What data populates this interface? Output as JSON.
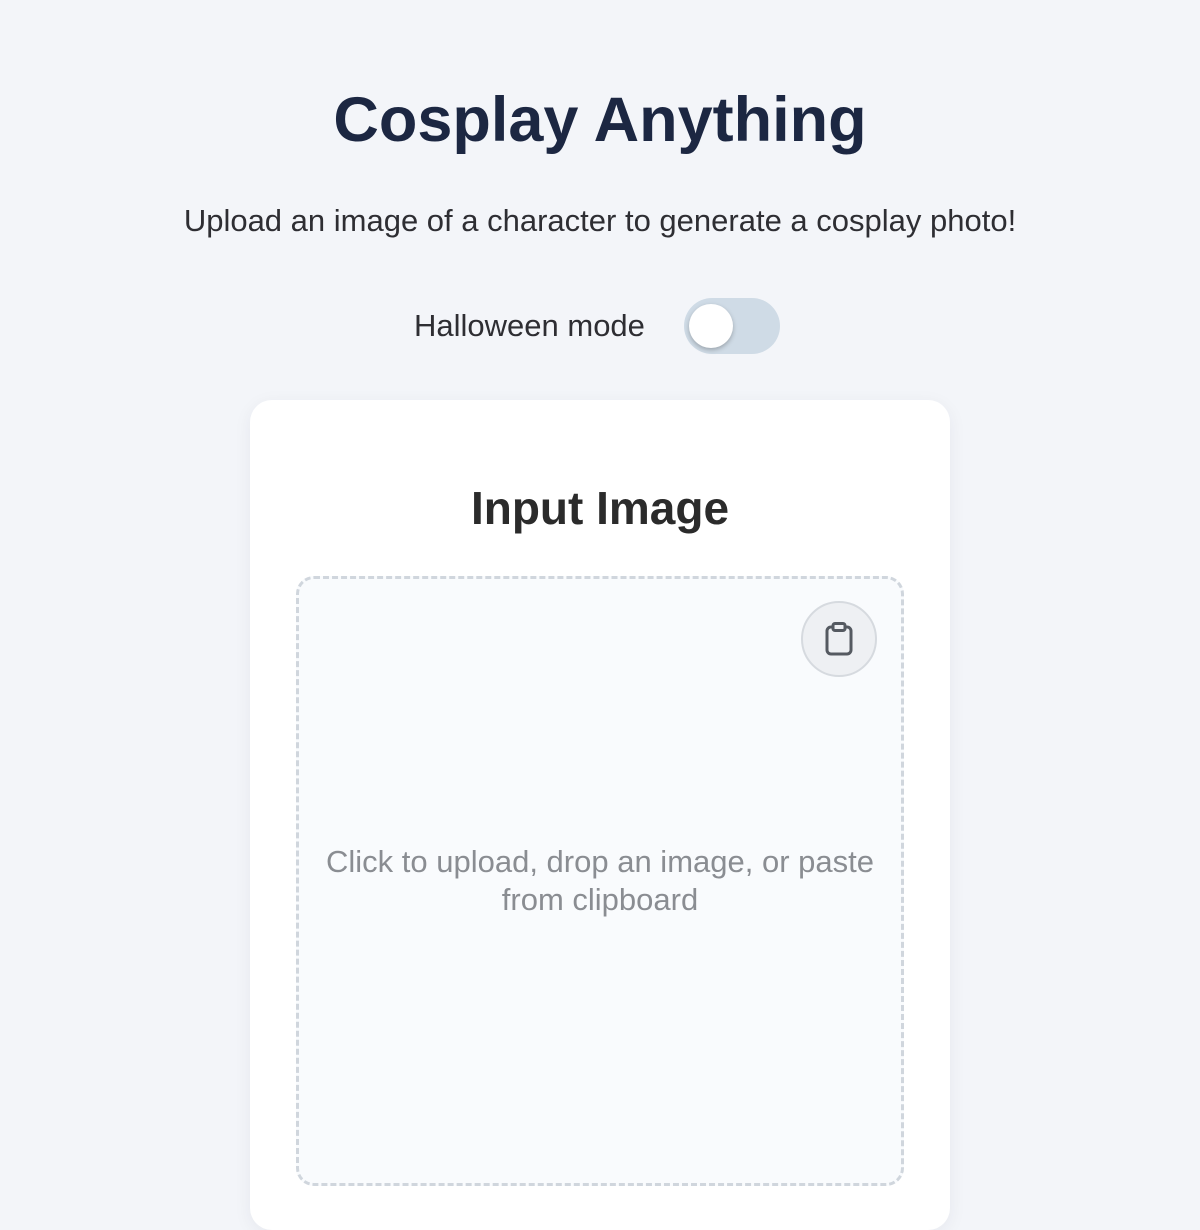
{
  "header": {
    "title": "Cosplay Anything",
    "subtitle": "Upload an image of a character to generate a cosplay photo!"
  },
  "halloween_toggle": {
    "label": "Halloween mode",
    "enabled": false
  },
  "input_card": {
    "title": "Input Image",
    "dropzone_text": "Click to upload, drop an image, or paste from clipboard",
    "paste_icon": "clipboard-icon"
  },
  "colors": {
    "background": "#f3f5f9",
    "title": "#1c2742",
    "toggle_track_off": "#cfdbe6",
    "card": "#ffffff",
    "dropzone_border": "#d0d6dd"
  }
}
